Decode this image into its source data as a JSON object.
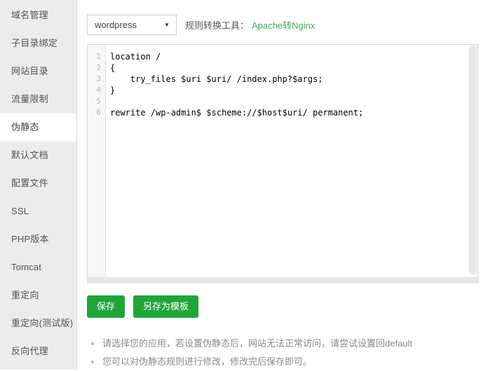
{
  "sidebar": {
    "items": [
      {
        "label": "域名管理",
        "active": false
      },
      {
        "label": "子目录绑定",
        "active": false
      },
      {
        "label": "网站目录",
        "active": false
      },
      {
        "label": "流量限制",
        "active": false
      },
      {
        "label": "伪静态",
        "active": true
      },
      {
        "label": "默认文档",
        "active": false
      },
      {
        "label": "配置文件",
        "active": false
      },
      {
        "label": "SSL",
        "active": false
      },
      {
        "label": "PHP版本",
        "active": false
      },
      {
        "label": "Tomcat",
        "active": false
      },
      {
        "label": "重定向",
        "active": false
      },
      {
        "label": "重定向(测试版)",
        "active": false
      },
      {
        "label": "反向代理",
        "active": false
      }
    ]
  },
  "toolbar": {
    "select": {
      "value": "wordpress",
      "caret_icon": "chevron-down-icon"
    },
    "converter_label": "规则转换工具：",
    "converter_link": "Apache转Nginx",
    "link_color": "#3fae4e"
  },
  "editor": {
    "line_numbers": [
      "1",
      "2",
      "3",
      "4",
      "5",
      "6"
    ],
    "lines": [
      "location /",
      "{",
      "    try_files $uri $uri/ /index.php?$args;",
      "}",
      "",
      "rewrite /wp-admin$ $scheme://$host$uri/ permanent;"
    ]
  },
  "buttons": {
    "save": "保存",
    "save_as_template": "另存为模板",
    "color": "#21a53a"
  },
  "tips": [
    "请选择您的应用，若设置伪静态后，网站无法正常访问，请尝试设置回default",
    "您可以对伪静态规则进行修改，修改完后保存即可。"
  ]
}
